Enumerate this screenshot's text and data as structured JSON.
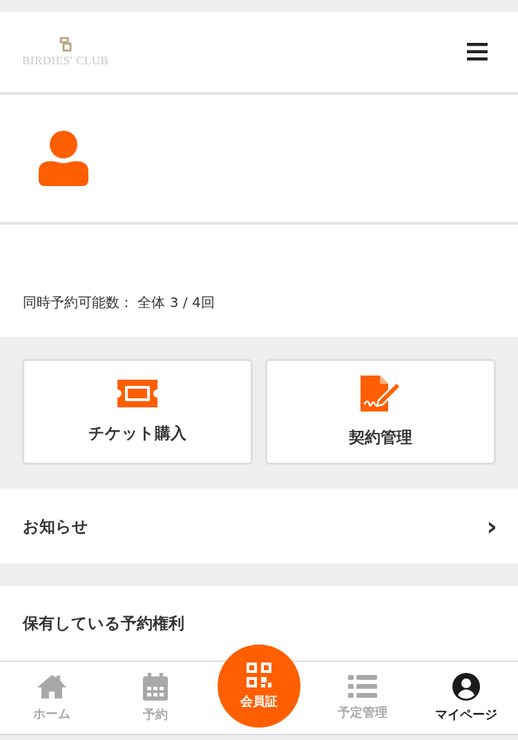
{
  "header": {
    "logo": "BIRDIES' CLUB"
  },
  "reservation_limit": {
    "label": "同時予約可能数：",
    "value": "全体 3 / 4回"
  },
  "actions": [
    {
      "kind": "ticket",
      "label": "チケット購入"
    },
    {
      "kind": "contract",
      "label": "契約管理"
    }
  ],
  "notices": {
    "label": "お知らせ",
    "chevron": "›"
  },
  "section_title": "保有している予約権利",
  "bottom_nav": [
    {
      "kind": "home",
      "label": "ホーム",
      "selected": false
    },
    {
      "kind": "calendar",
      "label": "予約",
      "selected": false
    },
    {
      "kind": "qr",
      "label": "会員証",
      "selected": false
    },
    {
      "kind": "list",
      "label": "予定管理",
      "selected": false
    },
    {
      "kind": "user",
      "label": "マイページ",
      "selected": true
    }
  ]
}
